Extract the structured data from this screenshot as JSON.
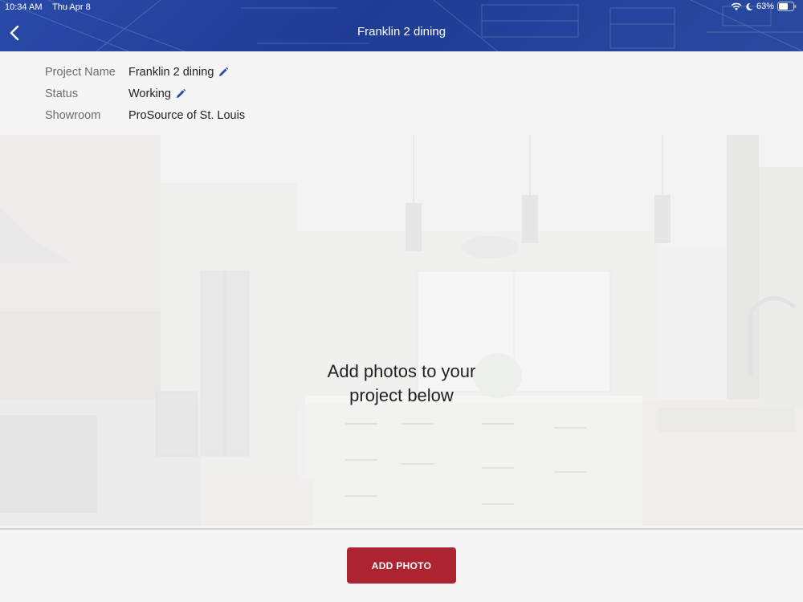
{
  "status_bar": {
    "time": "10:34 AM",
    "date": "Thu Apr 8",
    "battery": "63%"
  },
  "nav": {
    "title": "Franklin 2 dining",
    "back_icon": "chevron-left-icon"
  },
  "project": {
    "fields": [
      {
        "label": "Project Name",
        "value": "Franklin 2 dining",
        "editable": true
      },
      {
        "label": "Status",
        "value": "Working",
        "editable": true
      },
      {
        "label": "Showroom",
        "value": "ProSource of St. Louis",
        "editable": false
      }
    ]
  },
  "hero": {
    "line1": "Add photos to your",
    "line2": "project below"
  },
  "footer": {
    "add_photo_label": "ADD PHOTO"
  },
  "colors": {
    "header": "#1f3c95",
    "accent_button": "#ad2431",
    "edit_icon": "#2a4aa8"
  }
}
